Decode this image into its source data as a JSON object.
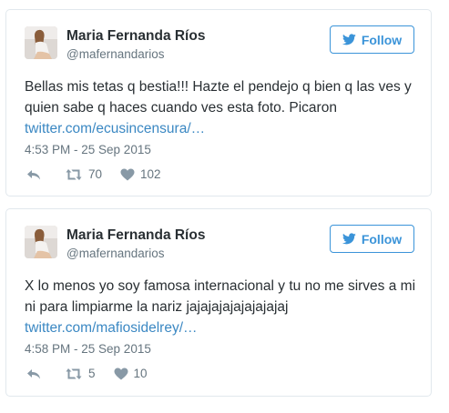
{
  "colors": {
    "accent": "#3b94d9",
    "link": "#3b88c3",
    "text": "#292f33",
    "secondary": "#66757f",
    "border": "#e1e8ed"
  },
  "tweets": [
    {
      "name": "Maria Fernanda Ríos",
      "handle": "@mafernandarios",
      "follow_label": "Follow",
      "text": "Bellas mis tetas q bestia!!! Hazte el pendejo q bien q las ves y quien sabe q haces cuando ves esta foto. Picaron",
      "link": "twitter.com/ecusincensura/…",
      "timestamp": "4:53 PM - 25 Sep 2015",
      "retweets": "70",
      "likes": "102",
      "icons": [
        "reply-icon",
        "retweet-icon",
        "heart-icon",
        "twitter-bird-icon"
      ]
    },
    {
      "name": "Maria Fernanda Ríos",
      "handle": "@mafernandarios",
      "follow_label": "Follow",
      "text": "X lo menos yo soy famosa internacional y tu no me sirves a mi ni para limpiarme la nariz jajajajajajajajajaj",
      "link": "twitter.com/mafiosidelrey/…",
      "timestamp": "4:58 PM - 25 Sep 2015",
      "retweets": "5",
      "likes": "10",
      "icons": [
        "reply-icon",
        "retweet-icon",
        "heart-icon",
        "twitter-bird-icon"
      ]
    }
  ]
}
